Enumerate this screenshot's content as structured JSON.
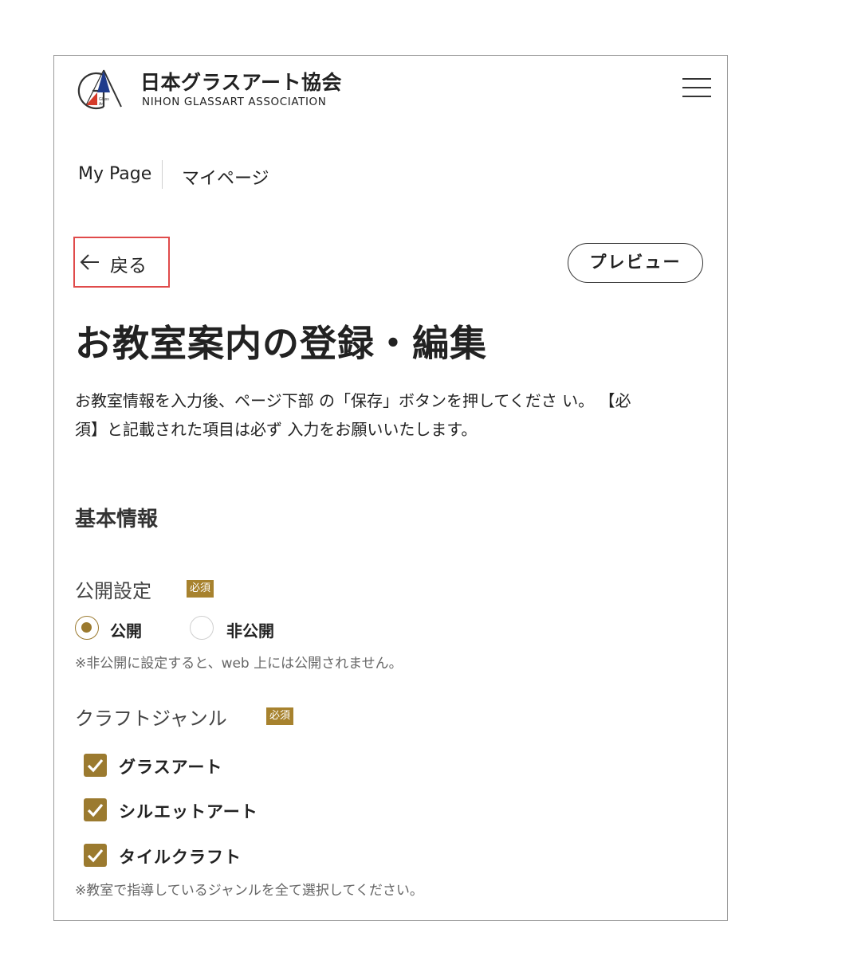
{
  "header": {
    "org_name_jp": "日本グラスアート協会",
    "org_name_en": "NIHON GLASSART ASSOCIATION",
    "logo_text_1": "Glass",
    "logo_text_2": "Art"
  },
  "page_heading": {
    "en": "My Page",
    "jp": "マイページ"
  },
  "actions": {
    "back_label": "戻る",
    "preview_label": "プレビュー"
  },
  "main": {
    "title": "お教室案内の登録・編集",
    "description_line1": "お教室情報を入力後、ページ下部 の「保存」ボタンを押してくださ い。 【必",
    "description_line2": "須】と記載された項目は必ず 入力をお願いいたします。"
  },
  "basic_info": {
    "heading": "基本情報",
    "publish_setting": {
      "label": "公開設定",
      "required": "必須",
      "options": [
        "公開",
        "非公開"
      ],
      "selected": "公開",
      "note": "※非公開に設定すると、web 上には公開されません。"
    },
    "craft_genre": {
      "label": "クラフトジャンル",
      "required": "必須",
      "options": [
        "グラスアート",
        "シルエットアート",
        "タイルクラフト"
      ],
      "checked": [
        true,
        true,
        true
      ],
      "note": "※教室で指導しているジャンルを全て選択してください。"
    }
  },
  "colors": {
    "accent_gold": "#9b7a2f",
    "badge_gold": "#a7822e",
    "highlight_red": "#e04b4b",
    "logo_blue": "#1f3b8c",
    "logo_red": "#d43a2a"
  }
}
